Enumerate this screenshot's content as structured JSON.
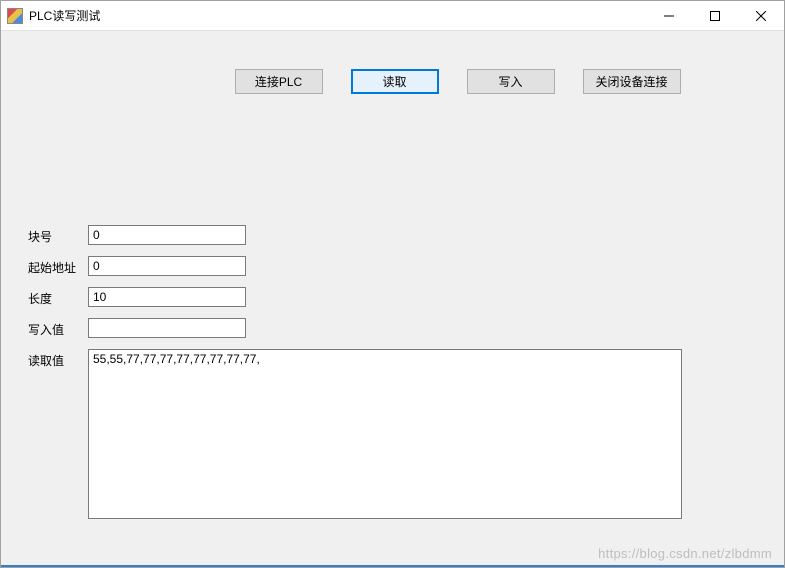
{
  "window": {
    "title": "PLC读写测试"
  },
  "toolbar": {
    "connect_label": "连接PLC",
    "read_label": "读取",
    "write_label": "写入",
    "close_label": "关闭设备连接"
  },
  "form": {
    "block_label": "块号",
    "block_value": "0",
    "start_addr_label": "起始地址",
    "start_addr_value": "0",
    "length_label": "长度",
    "length_value": "10",
    "write_value_label": "写入值",
    "write_value_value": "",
    "read_value_label": "读取值",
    "read_value_value": "55,55,77,77,77,77,77,77,77,77,"
  },
  "watermark": "https://blog.csdn.net/zlbdmm"
}
